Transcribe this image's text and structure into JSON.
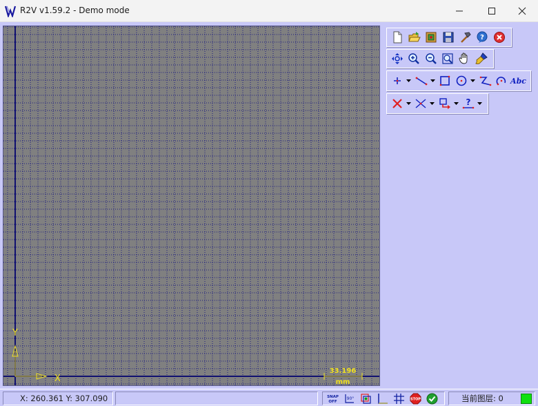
{
  "window": {
    "title": "R2V v1.59.2 - Demo mode"
  },
  "canvas": {
    "background": "#808080",
    "grid_color": "#1a1a80",
    "axis_color": "#101070",
    "axis_label_x": "X",
    "axis_label_y": "Y",
    "scale_value": "33.196",
    "scale_unit": "mm",
    "indicator_color": "#f0e020"
  },
  "toolbars": {
    "file": [
      "new-file-icon",
      "open-folder-icon",
      "import-icon",
      "save-icon",
      "hammer-icon",
      "help-icon",
      "close-red-icon"
    ],
    "view": [
      "pan-all-icon",
      "zoom-in-icon",
      "zoom-out-icon",
      "zoom-window-icon",
      "hand-pan-icon",
      "brush-icon"
    ],
    "draw": {
      "tools": [
        "point-icon",
        "line-icon",
        "rectangle-icon",
        "circle-icon",
        "polyline-icon",
        "arc-icon"
      ],
      "text_tool_label": "Abc"
    },
    "edit": [
      "delete-icon",
      "trim-icon",
      "move-icon",
      "query-icon"
    ]
  },
  "statusbar": {
    "coords": "X: 260.361 Y: 307.090",
    "snap_label_top": "SNAP",
    "snap_label_bottom": "OFF",
    "ortho_label": "90°",
    "stop_label": "STOP",
    "layer_text": "当前图层: 0",
    "layer_indicator_color": "#10e010"
  }
}
